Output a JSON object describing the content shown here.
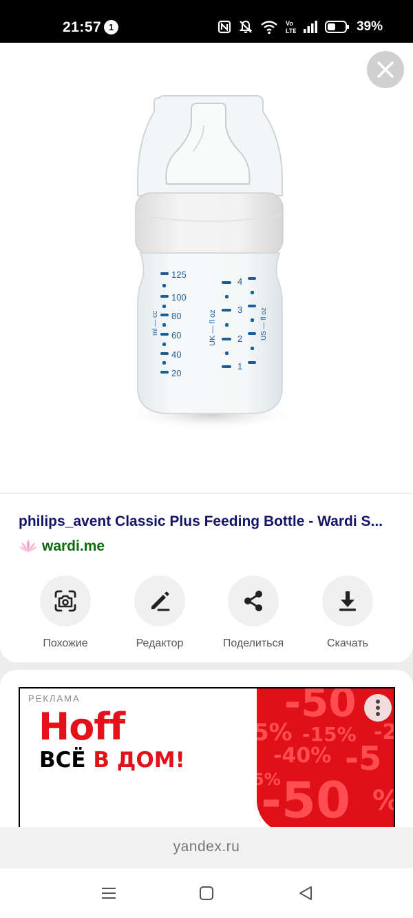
{
  "status_bar": {
    "time": "21:57",
    "notification_count": "1",
    "battery_percent": "39%",
    "icons": [
      "nfc-icon",
      "mute-icon",
      "wifi-icon",
      "volte-icon",
      "signal-icon",
      "battery-icon"
    ]
  },
  "image": {
    "description_icon": "baby-bottle-image",
    "ml_label": "ml — cc",
    "ml_marks": [
      "125",
      "100",
      "80",
      "60",
      "40",
      "20"
    ],
    "uk_label": "UK — fl oz",
    "oz_marks": [
      "4",
      "3",
      "2",
      "1"
    ],
    "us_label": "US — fl oz"
  },
  "close_button": {
    "icon": "close-icon"
  },
  "result": {
    "title": "philips_avent Classic Plus Feeding Bottle - Wardi S...",
    "source_domain": "wardi.me",
    "actions": [
      {
        "label": "Похожие",
        "icon": "camera-search-icon"
      },
      {
        "label": "Редактор",
        "icon": "pencil-icon"
      },
      {
        "label": "Поделиться",
        "icon": "share-icon"
      },
      {
        "label": "Скачать",
        "icon": "download-icon"
      }
    ]
  },
  "ad": {
    "label": "РЕКЛАМА",
    "brand": "Hoff",
    "slogan_black": "ВСЁ",
    "slogan_red": "В ДОМ!",
    "promo_texts": [
      "-50",
      "5%",
      "-15%",
      "-2",
      "-40%",
      "-5",
      "5%",
      "-50",
      "%"
    ]
  },
  "url_bar": {
    "url": "yandex.ru"
  },
  "nav": {
    "icons": [
      "menu-icon",
      "home-icon",
      "back-icon"
    ]
  },
  "colors": {
    "title": "#141466",
    "source": "#0b6b0b",
    "ad_red": "#e01019",
    "bottle_marks": "#1a5e9a"
  }
}
